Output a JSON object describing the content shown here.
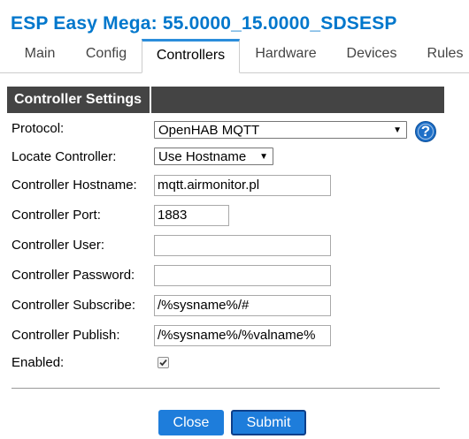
{
  "app": {
    "title": "ESP Easy Mega: 55.0000_15.0000_SDSESP"
  },
  "tabs": [
    {
      "label": "Main",
      "active": false
    },
    {
      "label": "Config",
      "active": false
    },
    {
      "label": "Controllers",
      "active": true
    },
    {
      "label": "Hardware",
      "active": false
    },
    {
      "label": "Devices",
      "active": false
    },
    {
      "label": "Rules",
      "active": false
    }
  ],
  "section": {
    "header": "Controller Settings"
  },
  "form": {
    "protocol": {
      "label": "Protocol:",
      "value": "OpenHAB MQTT",
      "help_icon": "question-mark-icon"
    },
    "locate": {
      "label": "Locate Controller:",
      "value": "Use Hostname"
    },
    "hostname": {
      "label": "Controller Hostname:",
      "value": "mqtt.airmonitor.pl"
    },
    "port": {
      "label": "Controller Port:",
      "value": "1883"
    },
    "user": {
      "label": "Controller User:",
      "value": ""
    },
    "password": {
      "label": "Controller Password:",
      "value": ""
    },
    "subscribe": {
      "label": "Controller Subscribe:",
      "value": "/%sysname%/#"
    },
    "publish": {
      "label": "Controller Publish:",
      "value": "/%sysname%/%valname%"
    },
    "enabled": {
      "label": "Enabled:",
      "checked": true
    }
  },
  "buttons": {
    "close": "Close",
    "submit": "Submit"
  },
  "colors": {
    "title": "#0077cc",
    "header_bg": "#444444",
    "button_bg": "#1e7ddb",
    "active_tab_accent": "#2b8ddb"
  }
}
